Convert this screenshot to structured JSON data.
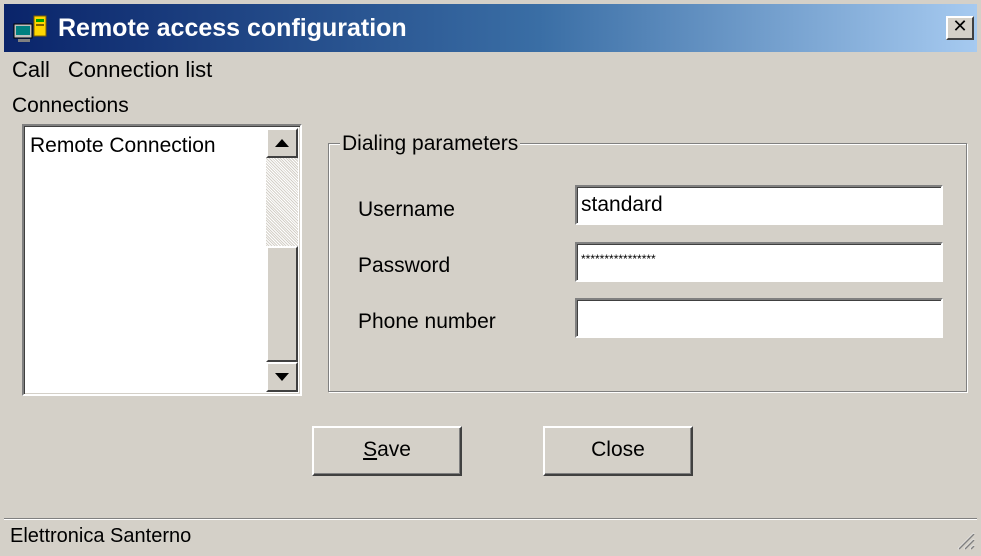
{
  "window": {
    "title": "Remote access configuration",
    "close_glyph": "✕"
  },
  "menu": {
    "items": [
      {
        "label": "Call"
      },
      {
        "label": "Connection list"
      }
    ]
  },
  "connections": {
    "label": "Connections",
    "items": [
      {
        "label": "Remote Connection"
      }
    ]
  },
  "dialing": {
    "legend": "Dialing parameters",
    "username_label": "Username",
    "username_value": "standard",
    "password_label": "Password",
    "password_value": "****************",
    "phone_label": "Phone number",
    "phone_value": ""
  },
  "buttons": {
    "save_mnemonic": "S",
    "save_rest": "ave",
    "close_label": "Close"
  },
  "status": {
    "text": "Elettronica Santerno"
  },
  "icons": {
    "app": "network-computer-icon",
    "close": "close-icon",
    "scroll_up": "arrow-up-icon",
    "scroll_down": "arrow-down-icon",
    "resize": "resize-grip-icon"
  },
  "colors": {
    "titlebar_start": "#0a246a",
    "titlebar_end": "#a6caf0",
    "face": "#d4d0c8"
  }
}
